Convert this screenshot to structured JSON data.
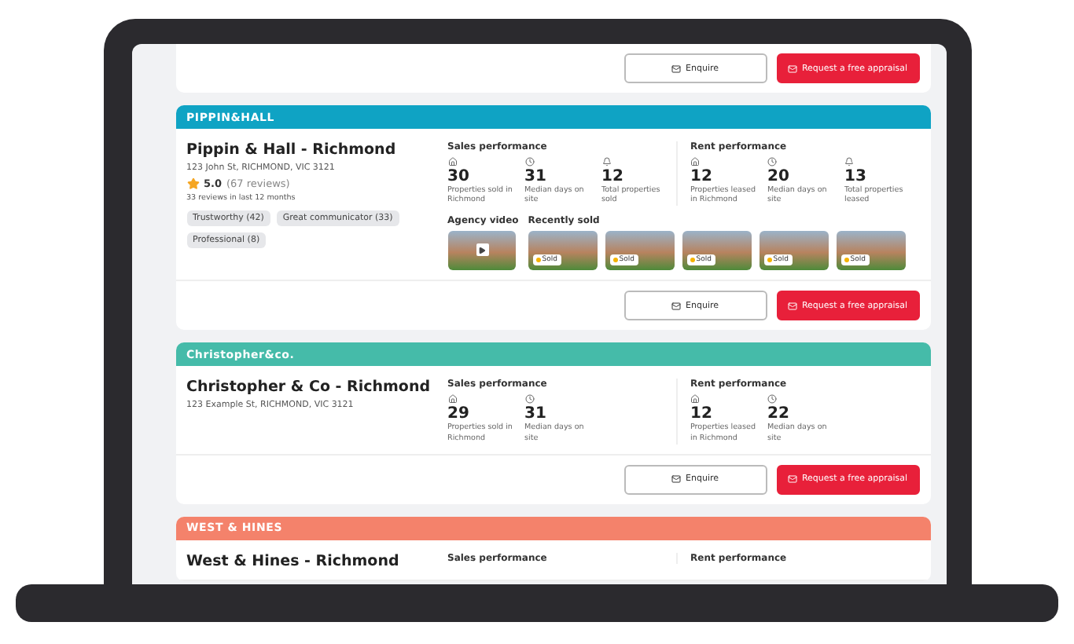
{
  "cards": [
    {
      "actions": [
        "Enquire",
        "Request a free appraisal"
      ]
    },
    {
      "logo": "PIPPIN&HALL",
      "color": "#0fa3c4",
      "name": "Pippin & Hall - Richmond",
      "address": "123 John St, RICHMOND, VIC 3121",
      "rating": "5.0",
      "reviews": "(67 reviews)",
      "recent_reviews": "33 reviews in last 12 months",
      "tags": [
        "Trustworthy (42)",
        "Great communicator (33)",
        "Professional (8)"
      ],
      "sales": {
        "title": "Sales performance",
        "stats": [
          {
            "value": "30",
            "label": "Properties sold in Richmond"
          },
          {
            "value": "31",
            "label": "Median days on site"
          },
          {
            "value": "12",
            "label": "Total properties sold"
          }
        ]
      },
      "rent": {
        "title": "Rent performance",
        "stats": [
          {
            "value": "12",
            "label": "Properties leased in Richmond"
          },
          {
            "value": "20",
            "label": "Median days on site"
          },
          {
            "value": "13",
            "label": "Total properties leased"
          }
        ]
      },
      "video_title": "Agency video",
      "sold_title": "Recently sold",
      "sold": [
        "Sold",
        "Sold",
        "Sold",
        "Sold",
        "Sold"
      ],
      "actions": [
        "Enquire",
        "Request a free appraisal"
      ]
    },
    {
      "logo": "Christopher&co.",
      "color": "#45bba9",
      "name": "Christopher & Co - Richmond",
      "address": "123 Example St, RICHMOND, VIC 3121",
      "sales": {
        "title": "Sales performance",
        "stats": [
          {
            "value": "29",
            "label": "Properties sold in Richmond"
          },
          {
            "value": "31",
            "label": "Median days on site"
          }
        ]
      },
      "rent": {
        "title": "Rent performance",
        "stats": [
          {
            "value": "12",
            "label": "Properties leased in Richmond"
          },
          {
            "value": "22",
            "label": "Median days on site"
          }
        ]
      },
      "actions": [
        "Enquire",
        "Request a free appraisal"
      ]
    },
    {
      "logo": "WEST & HINES",
      "color": "#f4826b",
      "name": "West & Hines - Richmond",
      "sales": {
        "title": "Sales performance"
      },
      "rent": {
        "title": "Rent performance"
      }
    }
  ]
}
